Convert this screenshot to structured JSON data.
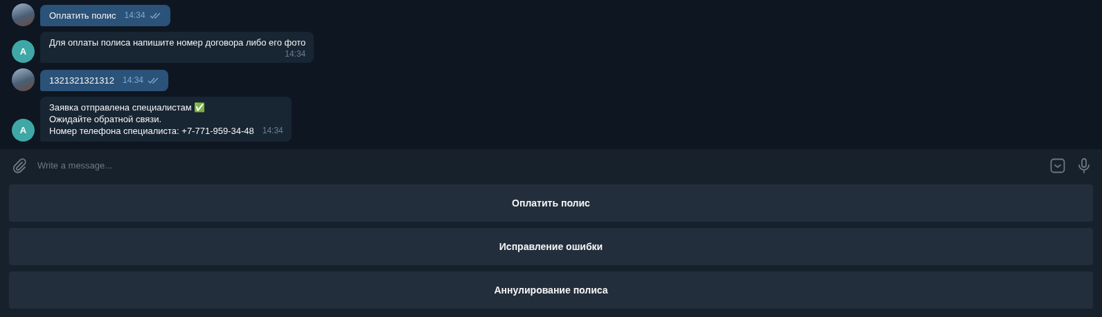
{
  "messages": [
    {
      "kind": "outgoing",
      "avatar": {
        "kind": "photo"
      },
      "lines": [
        "Оплатить полис"
      ],
      "time": "14:34",
      "read": true
    },
    {
      "kind": "incoming",
      "avatar": {
        "kind": "letter",
        "letter": "А"
      },
      "lines": [
        "Для оплаты полиса напишите номер договора либо его фото"
      ],
      "time": "14:34"
    },
    {
      "kind": "outgoing",
      "avatar": {
        "kind": "photo"
      },
      "lines": [
        "1321321321312"
      ],
      "time": "14:34",
      "read": true
    },
    {
      "kind": "incoming",
      "avatar": {
        "kind": "letter",
        "letter": "А"
      },
      "lines": [
        "Заявка отправлена специалистам ✅",
        "Ожидайте обратной связи.",
        "Номер телефона специалиста: +7-771-959-34-48"
      ],
      "time": "14:34"
    }
  ],
  "composer": {
    "placeholder": "Write a message..."
  },
  "keyboard_buttons": [
    "Оплатить полис",
    "Исправление ошибки",
    "Аннулирование полиса"
  ]
}
